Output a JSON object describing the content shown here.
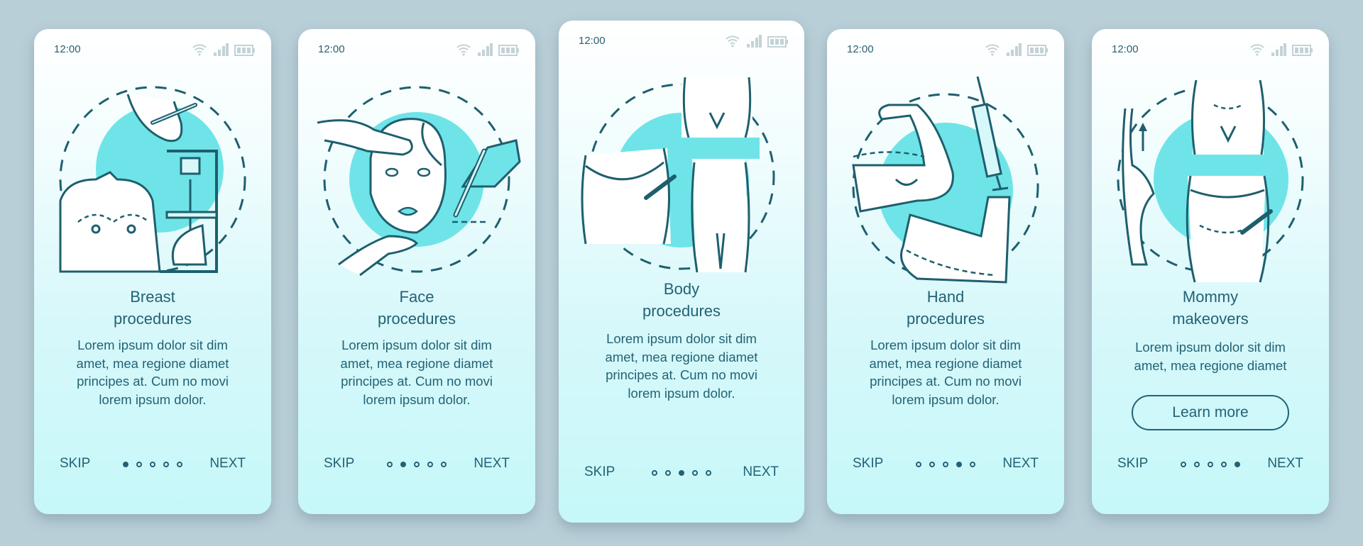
{
  "colors": {
    "accent": "#6fe4e8",
    "stroke": "#1e5f6e",
    "text": "#236275",
    "background": "#b9cfd8",
    "status_icons": "#c4d2d6"
  },
  "screens": [
    {
      "time": "12:00",
      "title_line1": "Breast",
      "title_line2": "procedures",
      "body": [
        "Lorem ipsum dolor sit dim",
        "amet, mea regione diamet",
        "principes at. Cum no movi",
        "lorem ipsum dolor."
      ],
      "skip": "SKIP",
      "next": "NEXT",
      "page": 1,
      "illustration": "breast-procedures-illustration"
    },
    {
      "time": "12:00",
      "title_line1": "Face",
      "title_line2": "procedures",
      "body": [
        "Lorem ipsum dolor sit dim",
        "amet, mea regione diamet",
        "principes at. Cum no movi",
        "lorem ipsum dolor."
      ],
      "skip": "SKIP",
      "next": "NEXT",
      "page": 2,
      "illustration": "face-procedures-illustration"
    },
    {
      "time": "12:00",
      "title_line1": "Body",
      "title_line2": "procedures",
      "body": [
        "Lorem ipsum dolor sit dim",
        "amet, mea regione diamet",
        "principes at. Cum no movi",
        "lorem ipsum dolor."
      ],
      "skip": "SKIP",
      "next": "NEXT",
      "page": 3,
      "illustration": "body-procedures-illustration"
    },
    {
      "time": "12:00",
      "title_line1": "Hand",
      "title_line2": "procedures",
      "body": [
        "Lorem ipsum dolor sit dim",
        "amet, mea regione diamet",
        "principes at. Cum no movi",
        "lorem ipsum dolor."
      ],
      "skip": "SKIP",
      "next": "NEXT",
      "page": 4,
      "illustration": "hand-procedures-illustration"
    },
    {
      "time": "12:00",
      "title_line1": "Mommy",
      "title_line2": "makeovers",
      "body": [
        "Lorem ipsum dolor sit dim",
        "amet, mea regione diamet"
      ],
      "button": "Learn more",
      "skip": "SKIP",
      "next": "NEXT",
      "page": 5,
      "illustration": "mommy-makeovers-illustration"
    }
  ],
  "pagination": {
    "total": 5
  }
}
